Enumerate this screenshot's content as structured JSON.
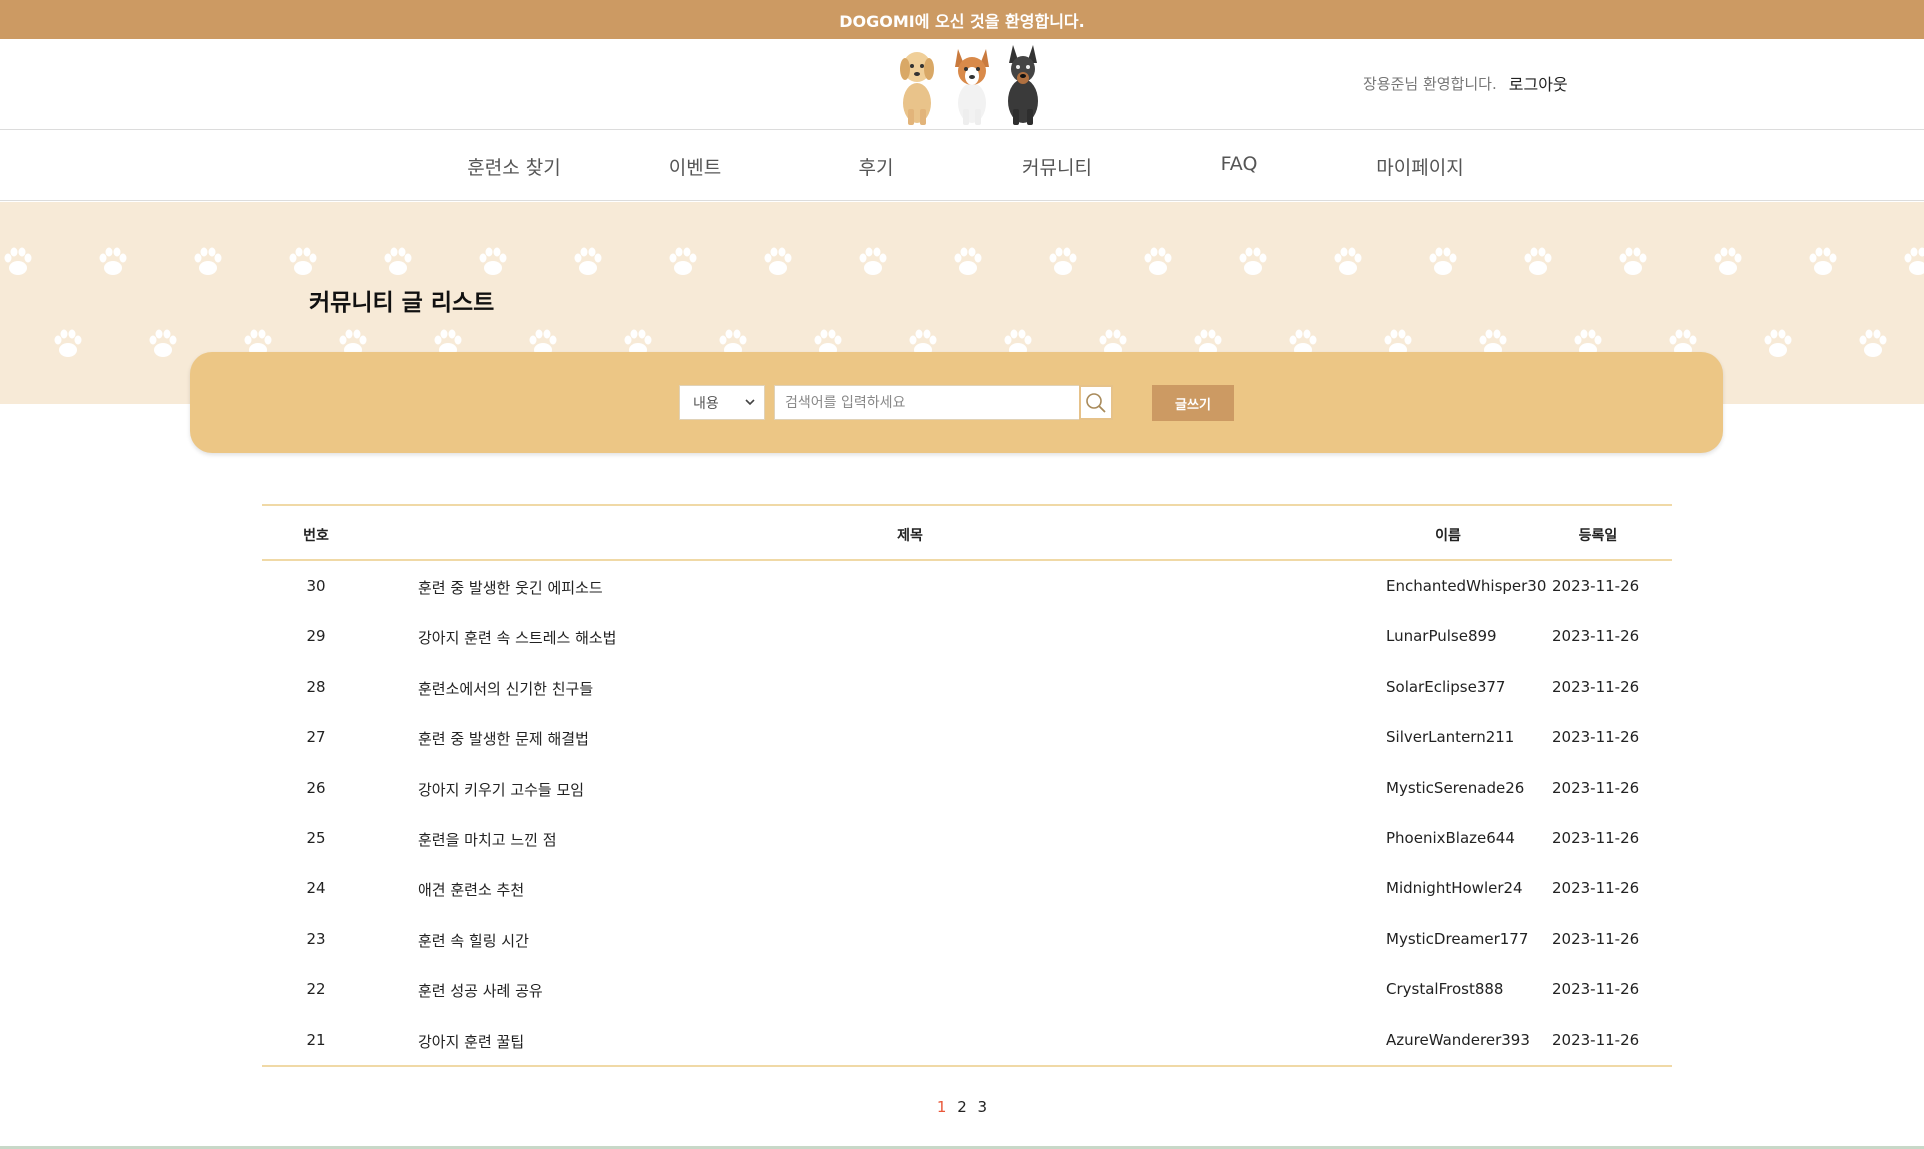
{
  "topbar": {
    "text": "DOGOMI에 오신 것을 환영합니다."
  },
  "header": {
    "user_greeting": "장용준님 환영합니다.",
    "logout_label": "로그아웃"
  },
  "nav": {
    "items": [
      {
        "label": "훈련소 찾기"
      },
      {
        "label": "이벤트"
      },
      {
        "label": "후기"
      },
      {
        "label": "커뮤니티"
      },
      {
        "label": "FAQ"
      },
      {
        "label": "마이페이지"
      }
    ]
  },
  "page": {
    "title": "커뮤니티 글 리스트"
  },
  "search": {
    "select_value": "내용",
    "placeholder": "검색어를 입력하세요",
    "write_label": "글쓰기",
    "icon": "search-icon"
  },
  "table": {
    "headers": {
      "no": "번호",
      "title": "제목",
      "name": "이름",
      "date": "등록일"
    },
    "rows": [
      {
        "no": "30",
        "title": "훈련 중 발생한 웃긴 에피소드",
        "name": "EnchantedWhisper30",
        "date": "2023-11-26"
      },
      {
        "no": "29",
        "title": "강아지 훈련 속 스트레스 해소법",
        "name": "LunarPulse899",
        "date": "2023-11-26"
      },
      {
        "no": "28",
        "title": "훈련소에서의 신기한 친구들",
        "name": "SolarEclipse377",
        "date": "2023-11-26"
      },
      {
        "no": "27",
        "title": "훈련 중 발생한 문제 해결법",
        "name": "SilverLantern211",
        "date": "2023-11-26"
      },
      {
        "no": "26",
        "title": "강아지 키우기 고수들 모임",
        "name": "MysticSerenade26",
        "date": "2023-11-26"
      },
      {
        "no": "25",
        "title": "훈련을 마치고 느낀 점",
        "name": "PhoenixBlaze644",
        "date": "2023-11-26"
      },
      {
        "no": "24",
        "title": "애견 훈련소 추천",
        "name": "MidnightHowler24",
        "date": "2023-11-26"
      },
      {
        "no": "23",
        "title": "훈련 속 힐링 시간",
        "name": "MysticDreamer177",
        "date": "2023-11-26"
      },
      {
        "no": "22",
        "title": "훈련 성공 사례 공유",
        "name": "CrystalFrost888",
        "date": "2023-11-26"
      },
      {
        "no": "21",
        "title": "강아지 훈련 꿀팁",
        "name": "AzureWanderer393",
        "date": "2023-11-26"
      }
    ]
  },
  "pagination": {
    "pages": [
      "1",
      "2",
      "3"
    ],
    "current": "1"
  },
  "colors": {
    "topbar": "#cc9a63",
    "banner": "#f7ead7",
    "search_panel": "#ecc685",
    "write_button": "#cc9a63",
    "active_page": "#e9583a"
  }
}
